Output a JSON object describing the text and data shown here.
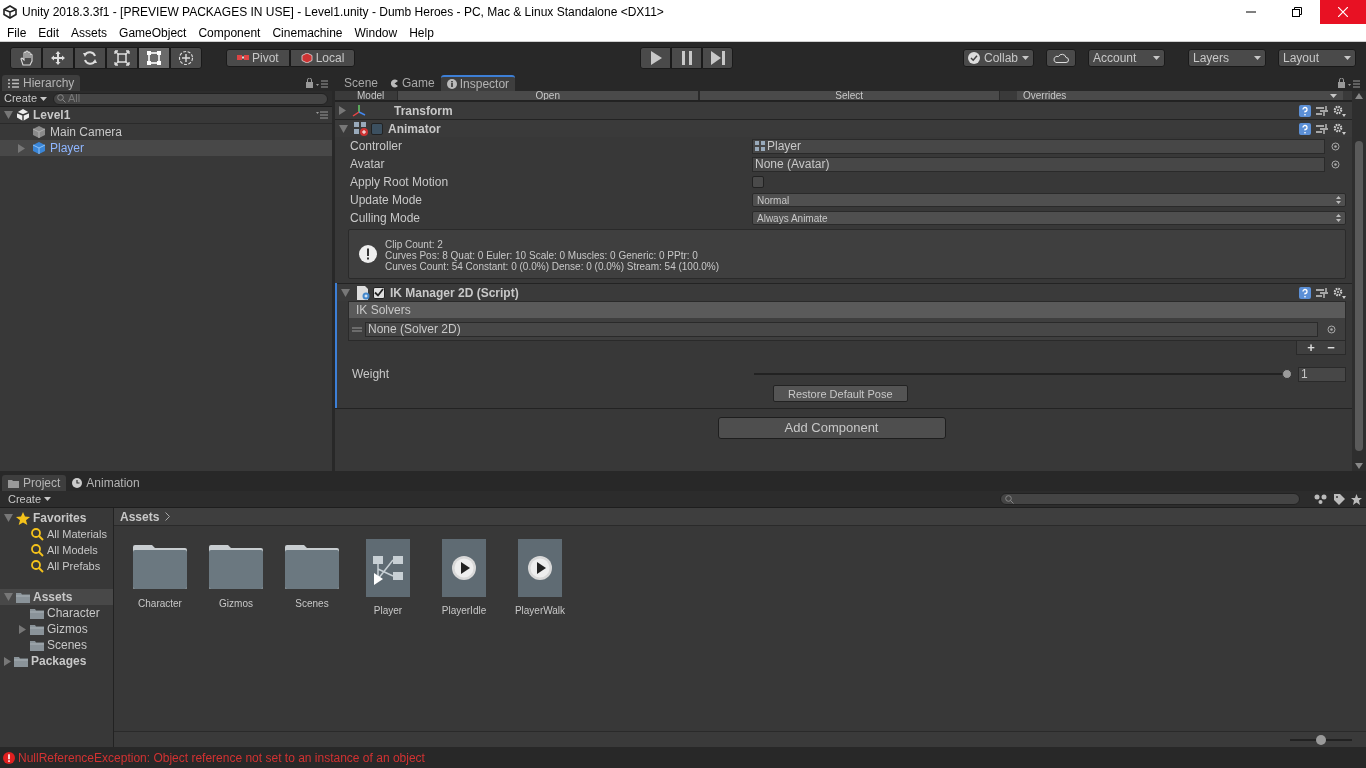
{
  "window": {
    "title": "Unity 2018.3.3f1 - [PREVIEW PACKAGES IN USE] - Level1.unity - Dumb Heroes - PC, Mac & Linux Standalone <DX11>"
  },
  "menu": [
    "File",
    "Edit",
    "Assets",
    "GameObject",
    "Component",
    "Cinemachine",
    "Window",
    "Help"
  ],
  "toolbar": {
    "tools": [
      {
        "kind": "hand",
        "selected": false
      },
      {
        "kind": "move",
        "selected": false
      },
      {
        "kind": "rotate",
        "selected": false
      },
      {
        "kind": "scale",
        "selected": false
      },
      {
        "kind": "rect",
        "selected": true
      },
      {
        "kind": "transform",
        "selected": false
      }
    ],
    "pivot": [
      "Pivot",
      "Local"
    ],
    "collab": "Collab",
    "account": "Account",
    "layers": "Layers",
    "layout": "Layout"
  },
  "hierarchy": {
    "tab": "Hierarchy",
    "create": "Create",
    "search_placeholder": "All",
    "scene": "Level1",
    "items": [
      {
        "name": "Main Camera",
        "kind": "leaf",
        "selected": false
      },
      {
        "name": "Player",
        "kind": "collapsed",
        "selected": true
      }
    ]
  },
  "inspector": {
    "tabs": [
      {
        "label": "Scene",
        "selected": false
      },
      {
        "label": "Game",
        "selected": false
      },
      {
        "label": "Inspector",
        "selected": true
      }
    ],
    "prefab": {
      "label": "Model",
      "buttons": [
        "Open",
        "Select"
      ],
      "overrides": "Overrides"
    },
    "components": [
      {
        "kind": "transform",
        "title": "Transform",
        "expanded": false
      },
      {
        "kind": "animator",
        "title": "Animator",
        "expanded": true,
        "enabled": false,
        "fields": [
          {
            "label": "Controller",
            "kind": "object",
            "value": "Player"
          },
          {
            "label": "Avatar",
            "kind": "object",
            "value": "None (Avatar)"
          },
          {
            "label": "Apply Root Motion",
            "kind": "checkbox",
            "checked": false
          },
          {
            "label": "Update Mode",
            "kind": "dropdown",
            "value": "Normal"
          },
          {
            "label": "Culling Mode",
            "kind": "dropdown",
            "value": "Always Animate"
          }
        ],
        "info": [
          "Clip Count: 2",
          "Curves Pos: 8 Quat: 0 Euler: 10 Scale: 0 Muscles: 0 Generic: 0 PPtr: 0",
          "Curves Count: 54 Constant: 0 (0.0%) Dense: 0 (0.0%) Stream: 54 (100.0%)"
        ]
      },
      {
        "kind": "ik",
        "title": "IK Manager 2D (Script)",
        "expanded": true,
        "enabled": true,
        "list_header": "IK Solvers",
        "list_items": [
          "None (Solver 2D)"
        ],
        "add": "+",
        "remove": "−",
        "weight": {
          "label": "Weight",
          "level": 1,
          "value": "1"
        },
        "restore": "Restore Default Pose"
      }
    ],
    "add_component": "Add Component"
  },
  "project": {
    "tabs": [
      {
        "label": "Project",
        "selected": true
      },
      {
        "label": "Animation",
        "selected": false
      }
    ],
    "create": "Create",
    "favorites": {
      "label": "Favorites",
      "items": [
        "All Materials",
        "All Models",
        "All Prefabs"
      ]
    },
    "tree": [
      {
        "name": "Assets",
        "selected": true,
        "expanded": true,
        "children": [
          {
            "name": "Character",
            "kind": "leaf"
          },
          {
            "name": "Gizmos",
            "kind": "collapsed"
          },
          {
            "name": "Scenes",
            "kind": "leaf"
          }
        ]
      },
      {
        "name": "Packages",
        "selected": false,
        "expanded": false
      }
    ],
    "breadcrumb": "Assets",
    "zoom": {
      "level": 0.5
    },
    "assets": [
      {
        "name": "Character",
        "kind": "folder"
      },
      {
        "name": "Gizmos",
        "kind": "folder"
      },
      {
        "name": "Scenes",
        "kind": "folder"
      },
      {
        "name": "Player",
        "kind": "controller"
      },
      {
        "name": "PlayerIdle",
        "kind": "clip"
      },
      {
        "name": "PlayerWalk",
        "kind": "clip"
      }
    ]
  },
  "status_bar": {
    "message": "NullReferenceException: Object reference not set to an instance of an object"
  }
}
